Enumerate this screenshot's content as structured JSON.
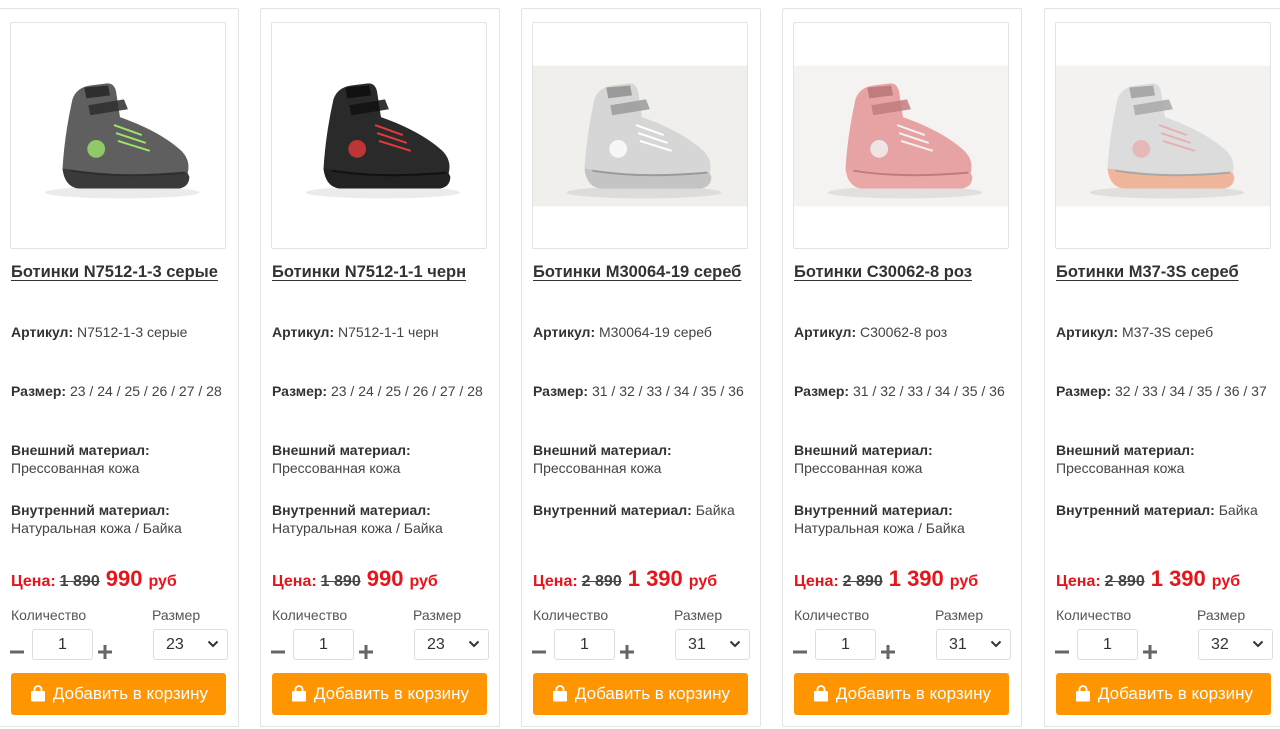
{
  "labels": {
    "article": "Артикул:",
    "size": "Размер:",
    "outer": "Внешний материал:",
    "inner": "Внутренний материал:",
    "price": "Цена:",
    "currency": "руб",
    "quantity": "Количество",
    "size_select": "Размер",
    "add_to_cart": "Добавить в корзину"
  },
  "colors": {
    "accent": "#ff9500",
    "price": "#e8141b"
  },
  "icons": {
    "cart": "shopping-bag-icon",
    "minus": "minus-icon",
    "plus": "plus-icon",
    "dropdown": "chevron-down-icon"
  },
  "products": [
    {
      "title": "Ботинки N7512-1-3 серые",
      "article": "N7512-1-3 серые",
      "sizes": "23 / 24 / 25 / 26 / 27 / 28",
      "outer": "Прессованная кожа",
      "inner": "Натуральная кожа / Байка",
      "old_price": "1 890",
      "new_price": "990",
      "quantity": "1",
      "selected_size": "23",
      "shoe_color": "gray"
    },
    {
      "title": "Ботинки N7512-1-1 черн",
      "article": "N7512-1-1 черн",
      "sizes": "23 / 24 / 25 / 26 / 27 / 28",
      "outer": "Прессованная кожа",
      "inner": "Натуральная кожа / Байка",
      "old_price": "1 890",
      "new_price": "990",
      "quantity": "1",
      "selected_size": "23",
      "shoe_color": "black"
    },
    {
      "title": "Ботинки M30064-19 сереб",
      "article": "M30064-19 сереб",
      "sizes": "31 / 32 / 33 / 34 / 35 / 36",
      "outer": "Прессованная кожа",
      "inner": "Байка",
      "old_price": "2 890",
      "new_price": "1 390",
      "quantity": "1",
      "selected_size": "31",
      "shoe_color": "silver"
    },
    {
      "title": "Ботинки C30062-8 роз",
      "article": "C30062-8 роз",
      "sizes": "31 / 32 / 33 / 34 / 35 / 36",
      "outer": "Прессованная кожа",
      "inner": "Натуральная кожа / Байка",
      "old_price": "2 890",
      "new_price": "1 390",
      "quantity": "1",
      "selected_size": "31",
      "shoe_color": "pink"
    },
    {
      "title": "Ботинки M37-3S сереб",
      "article": "M37-3S сереб",
      "sizes": "32 / 33 / 34 / 35 / 36 / 37",
      "outer": "Прессованная кожа",
      "inner": "Байка",
      "old_price": "2 890",
      "new_price": "1 390",
      "quantity": "1",
      "selected_size": "32",
      "shoe_color": "silver-peach"
    }
  ]
}
